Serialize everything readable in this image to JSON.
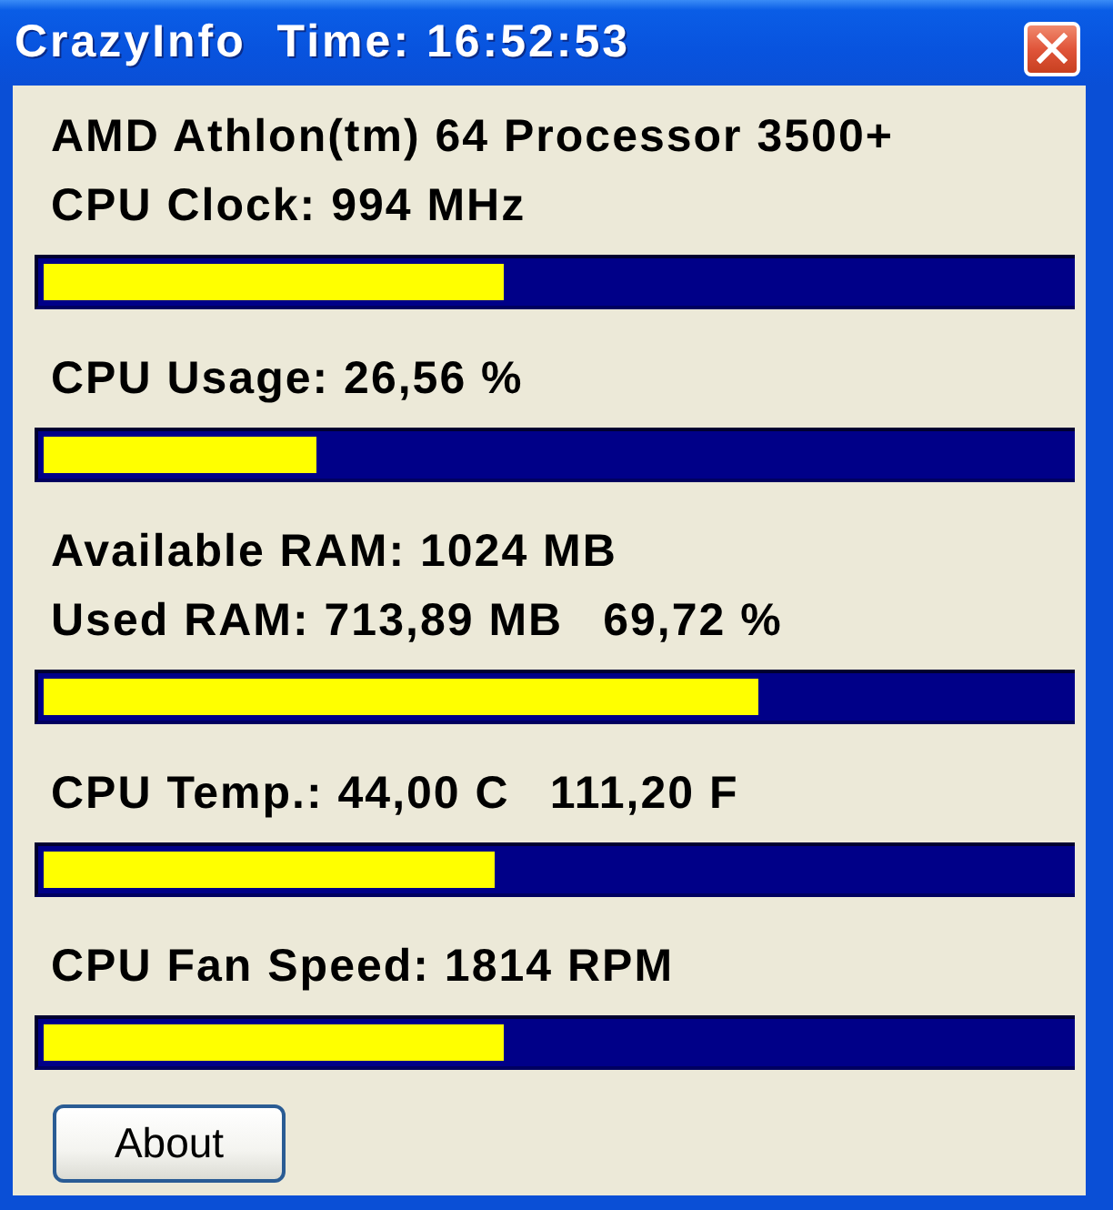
{
  "window": {
    "title": "CrazyInfo  Time: 16:52:53"
  },
  "sections": [
    {
      "lines": [
        [
          "AMD Athlon(tm) 64 Processor 3500+"
        ],
        [
          "CPU Clock: 994 MHz"
        ]
      ],
      "level": 0.45
    },
    {
      "lines": [
        [
          "CPU Usage: 26,56 %"
        ]
      ],
      "level": 0.2656
    },
    {
      "lines": [
        [
          "Available RAM: 1024 MB"
        ],
        [
          "Used RAM: 713,89 MB",
          "69,72 %"
        ]
      ],
      "level": 0.6972
    },
    {
      "lines": [
        [
          "CPU Temp.: 44,00 C",
          "111,20 F"
        ]
      ],
      "level": 0.44
    },
    {
      "lines": [
        [
          "CPU Fan Speed: 1814 RPM"
        ]
      ],
      "level": 0.45
    }
  ],
  "buttons": [
    "About"
  ]
}
